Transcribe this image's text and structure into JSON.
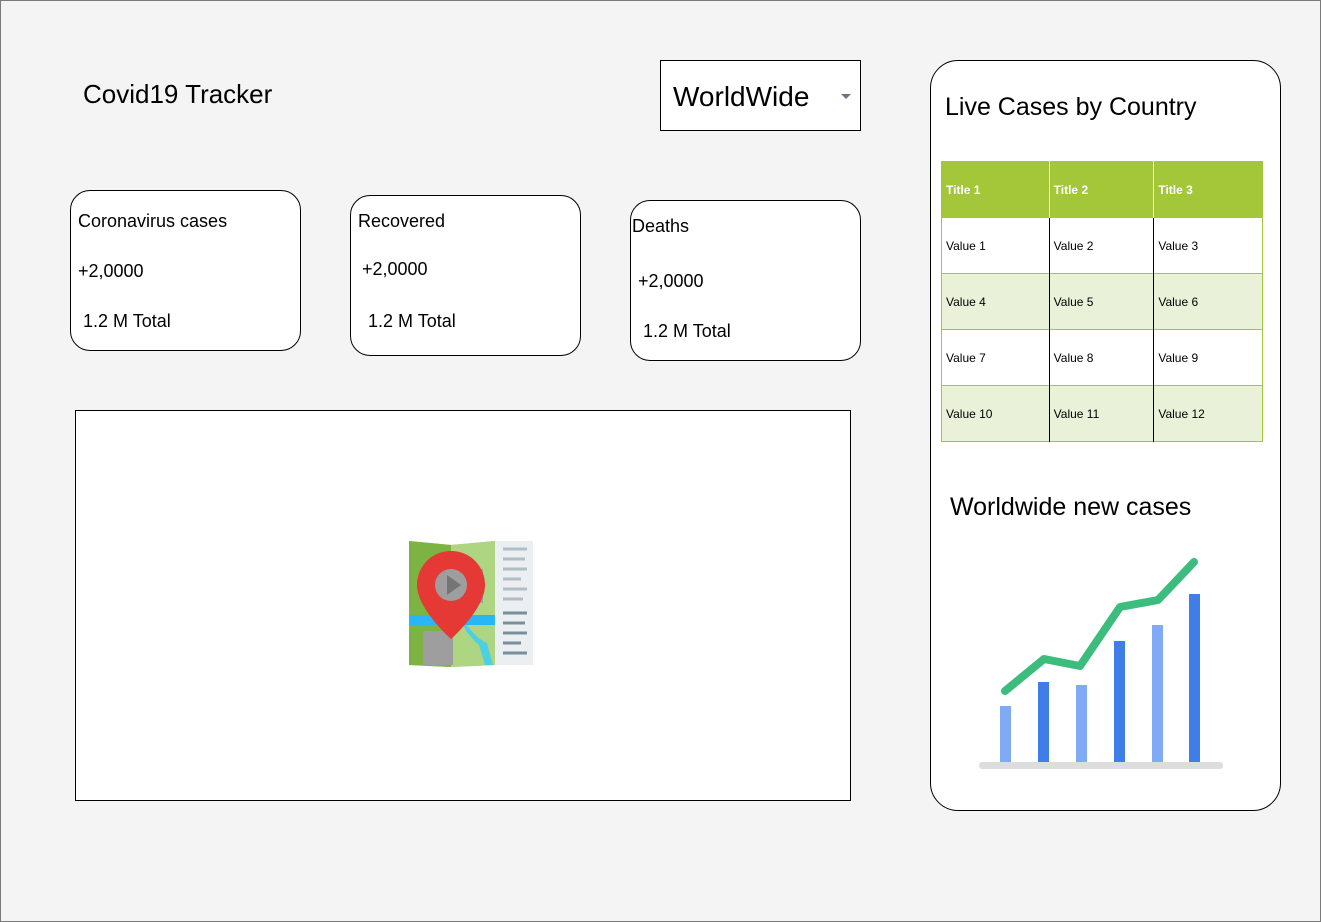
{
  "app": {
    "title": "Covid19 Tracker"
  },
  "country_select": {
    "value": "WorldWide"
  },
  "cards": {
    "cases": {
      "label": "Coronavirus cases",
      "today": "+2,0000",
      "total": "1.2 M Total"
    },
    "recovered": {
      "label": "Recovered",
      "today": "+2,0000",
      "total": "1.2 M Total"
    },
    "deaths": {
      "label": "Deaths",
      "today": "+2,0000",
      "total": "1.2 M Total"
    }
  },
  "map": {
    "icon": "map-pin-icon"
  },
  "live_cases": {
    "title": "Live Cases by Country",
    "headers": [
      "Title 1",
      "Title 2",
      "Title 3"
    ],
    "rows": [
      [
        "Value 1",
        "Value 2",
        "Value 3"
      ],
      [
        "Value 4",
        "Value 5",
        "Value 6"
      ],
      [
        "Value 7",
        "Value 8",
        "Value 9"
      ],
      [
        "Value 10",
        "Value 11",
        "Value 12"
      ]
    ],
    "colors": {
      "header": "#a4c639",
      "alt_row": "#e9f2d8"
    }
  },
  "new_cases": {
    "title": "Worldwide new cases",
    "icon": "bar-line-chart-icon",
    "colors": {
      "bar_light": "#80aaf5",
      "bar_dark": "#3f7ee8",
      "line": "#3dbd7d",
      "baseline": "#dddddd"
    }
  }
}
